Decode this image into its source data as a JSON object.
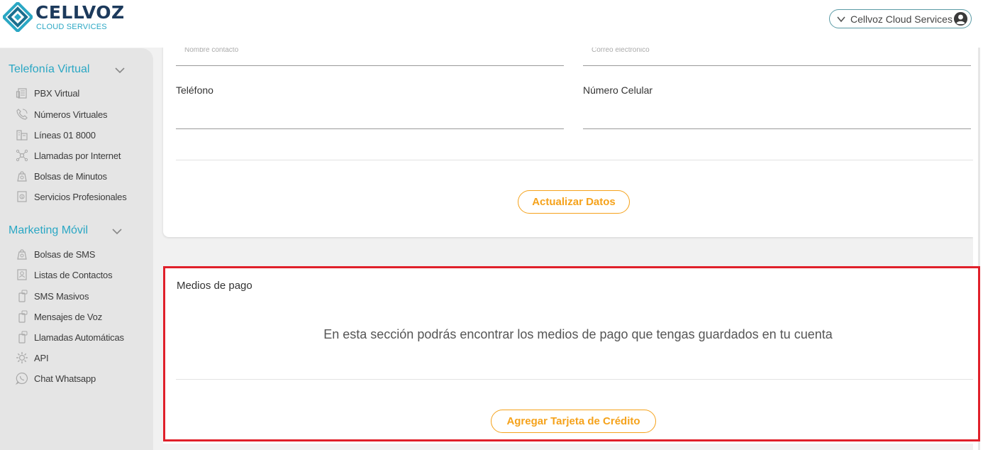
{
  "brand": {
    "name": "CELLVOZ",
    "subtitle": "CLOUD SERVICES",
    "colors": {
      "navy": "#1c3a5c",
      "teal": "#2aa7c4",
      "accent": "#f5a21b",
      "highlight": "#e0202a"
    }
  },
  "account": {
    "label": "Cellvoz Cloud Services",
    "icon": "user-circle-icon"
  },
  "sidebar": {
    "sections": [
      {
        "title": "Telefonía Virtual",
        "items": [
          {
            "label": "PBX Virtual",
            "icon": "pbx-icon"
          },
          {
            "label": "Números Virtuales",
            "icon": "phone-icon"
          },
          {
            "label": "Líneas 01 8000",
            "icon": "building-icon"
          },
          {
            "label": "Llamadas por Internet",
            "icon": "network-icon"
          },
          {
            "label": "Bolsas de Minutos",
            "icon": "bag-icon"
          },
          {
            "label": "Servicios Profesionales",
            "icon": "services-icon"
          }
        ]
      },
      {
        "title": "Marketing Móvil",
        "items": [
          {
            "label": "Bolsas de SMS",
            "icon": "bag-icon"
          },
          {
            "label": "Listas de Contactos",
            "icon": "contacts-icon"
          },
          {
            "label": "SMS Masivos",
            "icon": "mobile-icon"
          },
          {
            "label": "Mensajes de Voz",
            "icon": "mobile-icon"
          },
          {
            "label": "Llamadas Automáticas",
            "icon": "mobile-icon"
          },
          {
            "label": "API",
            "icon": "gear-icon"
          },
          {
            "label": "Chat Whatsapp",
            "icon": "whatsapp-icon"
          }
        ]
      }
    ]
  },
  "profile_form": {
    "contact_name_label": "Nombre contacto",
    "email_label": "Correo electrónico",
    "phone_label": "Teléfono",
    "mobile_label": "Número Celular",
    "update_button": "Actualizar Datos"
  },
  "payment": {
    "title": "Medios de pago",
    "message": "En esta sección podrás encontrar los medios de pago que tengas guardados en tu cuenta",
    "add_card_button": "Agregar Tarjeta de Crédito"
  }
}
